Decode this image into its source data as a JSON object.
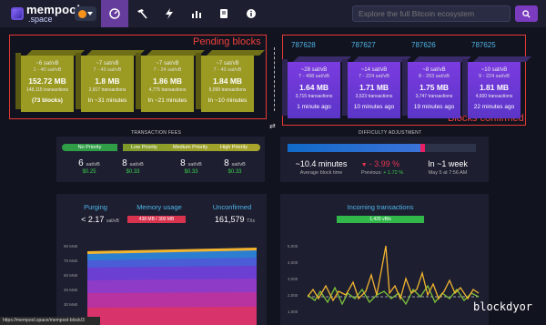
{
  "header": {
    "logo_line1": "mempool",
    "logo_line2": ".space",
    "search_placeholder": "Explore the full Bitcoin ecosystem",
    "nav_icons": [
      "dashboard-icon",
      "mining-icon",
      "lightning-icon",
      "graphs-icon",
      "docs-icon",
      "info-icon"
    ]
  },
  "annotations": {
    "pending": "Pending blocks",
    "confirmed": "Blocks confirmed"
  },
  "pending_blocks": [
    {
      "fee": "~6 sat/vB",
      "range": "1 - 40 sat/vB",
      "size": "152.72 MB",
      "tx": "148,115 transactions",
      "time": "(73 blocks)",
      "bold_time": true
    },
    {
      "fee": "~7 sat/vB",
      "range": "7 - 43 sat/vB",
      "size": "1.8 MB",
      "tx": "2,917 transactions",
      "time": "In ~31 minutes",
      "bold_time": false
    },
    {
      "fee": "~7 sat/vB",
      "range": "7 - 24 sat/vB",
      "size": "1.86 MB",
      "tx": "4,775 transactions",
      "time": "In ~21 minutes",
      "bold_time": false
    },
    {
      "fee": "~7 sat/vB",
      "range": "7 - 43 sat/vB",
      "size": "1.84 MB",
      "tx": "5,099 transactions",
      "time": "In ~10 minutes",
      "bold_time": false
    }
  ],
  "confirmed_blocks": [
    {
      "height": "787628",
      "fee": "~28 sat/vB",
      "range": "7 - 498 sat/vB",
      "size": "1.64 MB",
      "tx": "3,715 transactions",
      "time": "1 minute ago"
    },
    {
      "height": "787627",
      "fee": "~14 sat/vB",
      "range": "7 - 224 sat/vB",
      "size": "1.71 MB",
      "tx": "3,523 transactions",
      "time": "10 minutes ago"
    },
    {
      "height": "787626",
      "fee": "~8 sat/vB",
      "range": "8 - 203 sat/vB",
      "size": "1.75 MB",
      "tx": "3,747 transactions",
      "time": "19 minutes ago"
    },
    {
      "height": "787625",
      "fee": "~10 sat/vB",
      "range": "9 - 224 sat/vB",
      "size": "1.81 MB",
      "tx": "4,600 transactions",
      "time": "22 minutes ago"
    }
  ],
  "fees": {
    "title": "TRANSACTION FEES",
    "labels": [
      "No Priority",
      "Low Priority",
      "Medium Priority",
      "High Priority"
    ],
    "values": [
      "6",
      "8",
      "8",
      "8"
    ],
    "unit": "sat/vB",
    "usd": [
      "$0.25",
      "$0.33",
      "$0.33",
      "$0.33"
    ]
  },
  "difficulty": {
    "title": "DIFFICULTY ADJUSTMENT",
    "progress_fraction": 0.73,
    "eta": "~10.4 minutes",
    "eta_label": "Average block time",
    "change": "- 3.99 %",
    "previous_label": "Previous:",
    "previous_val": "+ 1.72 %",
    "next": "In ~1 week",
    "next_date": "May 5 at 7:56 AM"
  },
  "mempool": {
    "purging_label": "Purging",
    "purging_val": "< 2.17",
    "purging_unit": "sat/vB",
    "memory_label": "Memory usage",
    "memory_val": "438 MB / 300 MB",
    "unconfirmed_label": "Unconfirmed",
    "unconfirmed_val": "161,579",
    "unconfirmed_unit": "TXs",
    "y_ticks": [
      "90 MvB",
      "75 MvB",
      "60 MvB",
      "45 MvB",
      "30 MvB",
      "15 MvB"
    ]
  },
  "incoming": {
    "title": "Incoming transactions",
    "rate": "1,425 vB/s",
    "y_ticks": [
      "5,000",
      "4,000",
      "3,000",
      "2,000",
      "1,000"
    ]
  },
  "status_url": "https://mempool.space/mempool-block/3",
  "watermark": "blockdyor",
  "colors": {
    "accent": "#653b9c",
    "pending_block": "#9b9a22",
    "confirmed_block": "#5b35c8",
    "annotation": "#e53935",
    "height_text": "#4fb4e8"
  }
}
